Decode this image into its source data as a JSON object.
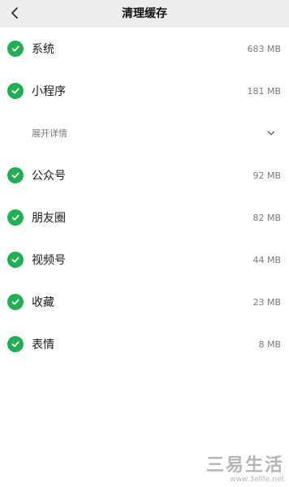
{
  "header": {
    "title": "清理缓存",
    "back_icon": "chevron-left-icon"
  },
  "items": [
    {
      "label": "系统",
      "size": "683 MB",
      "checked": true
    },
    {
      "label": "小程序",
      "size": "181 MB",
      "checked": true
    },
    {
      "label": "公众号",
      "size": "92 MB",
      "checked": true
    },
    {
      "label": "朋友圈",
      "size": "82 MB",
      "checked": true
    },
    {
      "label": "视频号",
      "size": "44 MB",
      "checked": true
    },
    {
      "label": "收藏",
      "size": "23 MB",
      "checked": true
    },
    {
      "label": "表情",
      "size": "8 MB",
      "checked": true
    }
  ],
  "expand": {
    "label": "展开详情",
    "icon": "chevron-down-icon"
  },
  "watermark": {
    "text": "三易生活",
    "url": "www.3elife.net"
  },
  "colors": {
    "accent": "#1fb052",
    "header_bg": "#ededed",
    "secondary_text": "#7a7a7a"
  }
}
